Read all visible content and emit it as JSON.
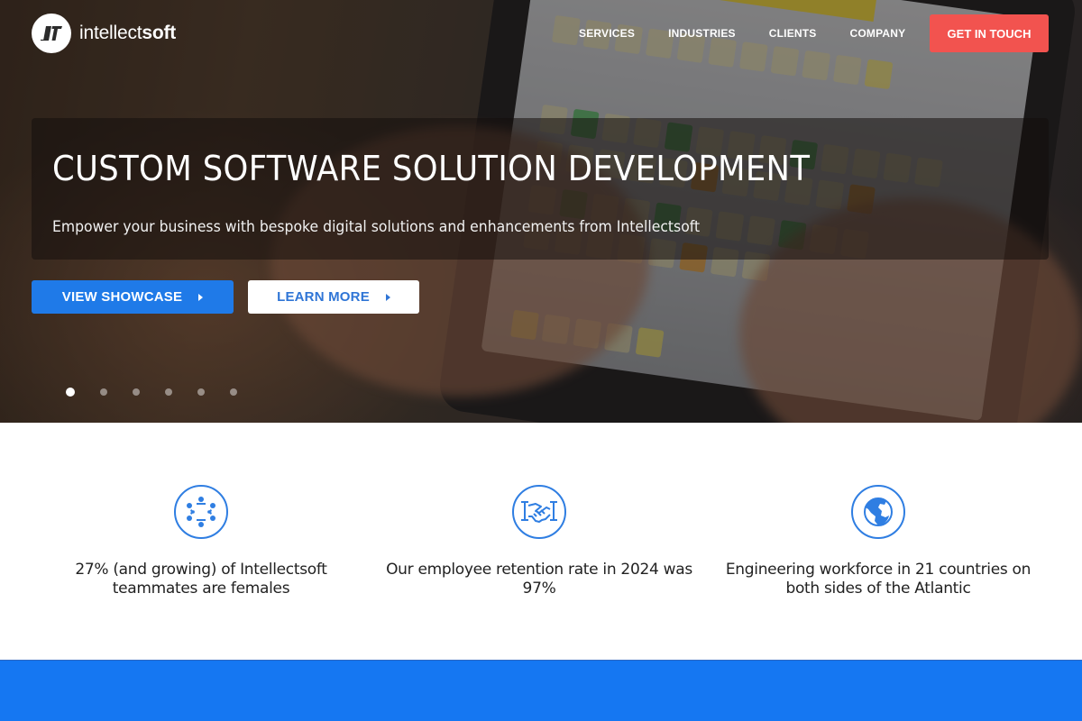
{
  "brand": {
    "logo_text_light": "intellect",
    "logo_text_bold": "soft",
    "accent_blue": "#1f7ae8",
    "cta_red": "#f2534f"
  },
  "nav": {
    "items": [
      {
        "label": "SERVICES"
      },
      {
        "label": "INDUSTRIES"
      },
      {
        "label": "CLIENTS"
      },
      {
        "label": "COMPANY"
      }
    ],
    "cta_label": "GET IN TOUCH"
  },
  "hero": {
    "headline": "CUSTOM SOFTWARE SOLUTION DEVELOPMENT",
    "subheadline": "Empower your business with bespoke digital solutions and enhancements from Intellectsoft",
    "primary_button": "VIEW SHOWCASE",
    "secondary_button": "LEARN MORE",
    "carousel": {
      "slide_count": 6,
      "active_index": 0
    }
  },
  "features": [
    {
      "icon": "team-circle-icon",
      "text": "27% (and growing) of Intellectsoft teammates are females"
    },
    {
      "icon": "handshake-icon",
      "text": "Our employee retention rate in 2024 was 97%"
    },
    {
      "icon": "globe-icon",
      "text": "Engineering workforce in 21 countries on both sides of the Atlantic"
    }
  ]
}
